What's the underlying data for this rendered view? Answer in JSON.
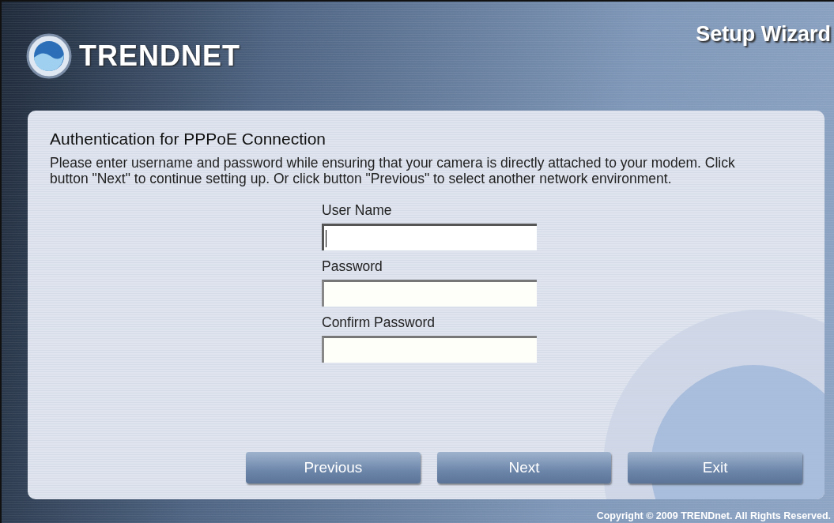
{
  "header": {
    "logo": "TRENDNET",
    "title": "Setup Wizard"
  },
  "panel": {
    "heading": "Authentication for PPPoE Connection",
    "description": "Please enter username and password while ensuring that your camera is directly attached to your modem. Click button \"Next\" to continue setting up. Or click button \"Previous\" to select another network environment.",
    "fields": [
      {
        "label": "User Name",
        "focused": true
      },
      {
        "label": "Password",
        "focused": false
      },
      {
        "label": "Confirm Password",
        "focused": false
      }
    ],
    "buttons": [
      "Previous",
      "Next",
      "Exit"
    ]
  },
  "footer": {
    "copyright": "Copyright © 2009 TRENDnet. All Rights Reserved."
  }
}
